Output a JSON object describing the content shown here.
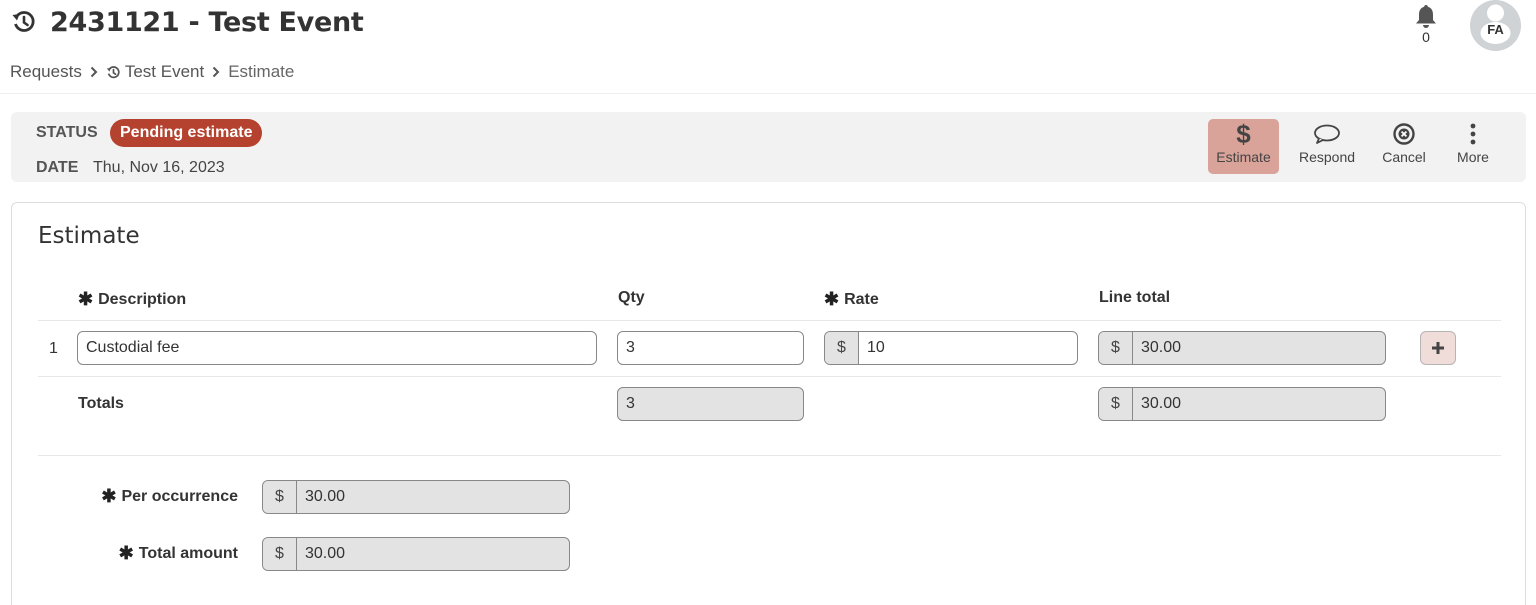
{
  "header": {
    "title": "2431121 - Test Event",
    "icons": {
      "title": "history-icon",
      "bell": "bell-icon",
      "avatar": "user-avatar"
    },
    "notifications_count": "0",
    "avatar_initials": "FA"
  },
  "breadcrumb": {
    "items": [
      "Requests",
      "Test Event",
      "Estimate"
    ]
  },
  "status_bar": {
    "status_label": "STATUS",
    "status_value": "Pending estimate",
    "status_color": "#b5422e",
    "date_label": "DATE",
    "date_value": "Thu, Nov 16, 2023",
    "actions": [
      {
        "label": "Estimate",
        "icon": "dollar-icon",
        "active": true
      },
      {
        "label": "Respond",
        "icon": "speech-bubble-icon",
        "active": false
      },
      {
        "label": "Cancel",
        "icon": "cancel-circle-icon",
        "active": false
      },
      {
        "label": "More",
        "icon": "more-vertical-icon",
        "active": false
      }
    ]
  },
  "estimate": {
    "title": "Estimate",
    "columns": {
      "description": "Description",
      "qty": "Qty",
      "rate": "Rate",
      "line_total": "Line total"
    },
    "currency_symbol": "$",
    "lines": [
      {
        "number": "1",
        "description": "Custodial fee",
        "qty": "3",
        "rate": "10",
        "line_total": "30.00"
      }
    ],
    "totals": {
      "label": "Totals",
      "qty": "3",
      "line_total": "30.00"
    },
    "per_occurrence": {
      "label": "Per occurrence",
      "value": "30.00"
    },
    "total_amount": {
      "label": "Total amount",
      "value": "30.00"
    }
  }
}
